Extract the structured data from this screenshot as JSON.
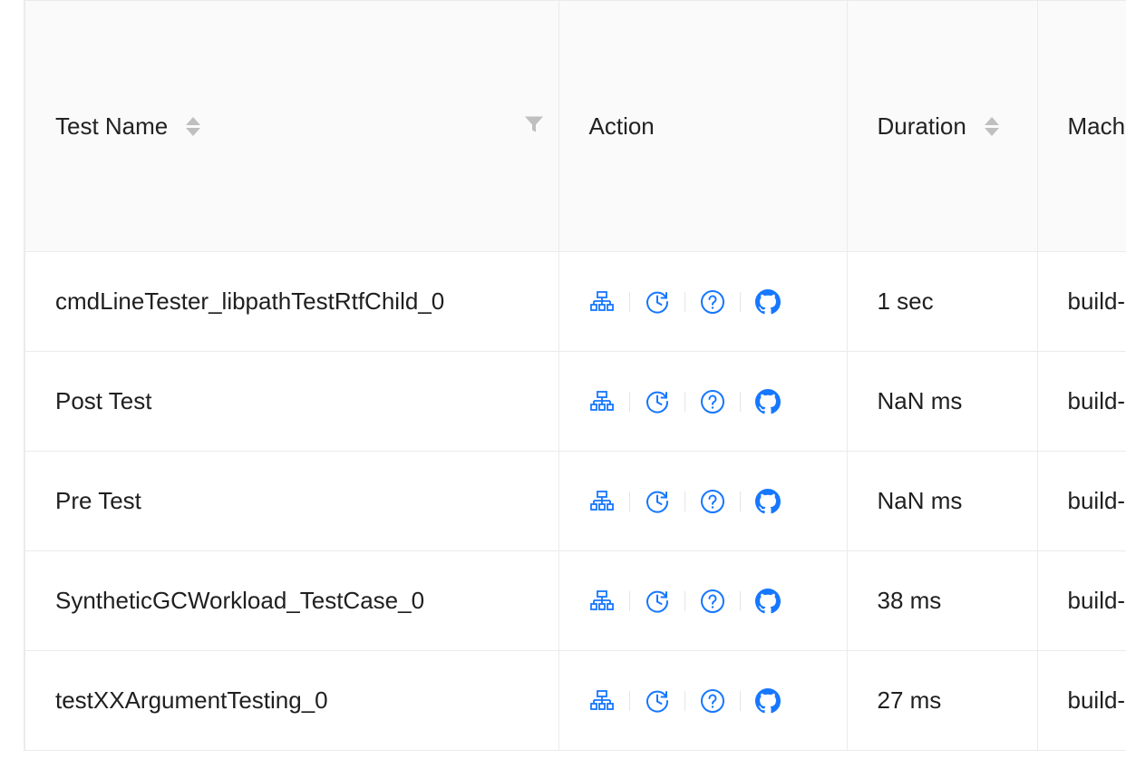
{
  "table": {
    "columns": [
      {
        "key": "name",
        "label": "Test Name"
      },
      {
        "key": "action",
        "label": "Action"
      },
      {
        "key": "duration",
        "label": "Duration"
      },
      {
        "key": "machine",
        "label": "Mach"
      }
    ],
    "rows": [
      {
        "name": "cmdLineTester_libpathTestRtfChild_0",
        "duration": "1 sec",
        "machine": "build-"
      },
      {
        "name": "Post Test",
        "duration": "NaN ms",
        "machine": "build-"
      },
      {
        "name": "Pre Test",
        "duration": "NaN ms",
        "machine": "build-"
      },
      {
        "name": "SyntheticGCWorkload_TestCase_0",
        "duration": "38 ms",
        "machine": "build-"
      },
      {
        "name": "testXXArgumentTesting_0",
        "duration": "27 ms",
        "machine": "build-"
      }
    ],
    "action_icons": [
      "cluster-icon",
      "history-icon",
      "question-circle-icon",
      "github-icon"
    ]
  },
  "colors": {
    "accent": "#1677ff",
    "header_bg": "#fafafa",
    "border": "#ebebeb",
    "sort_icon": "#bfbfbf"
  }
}
